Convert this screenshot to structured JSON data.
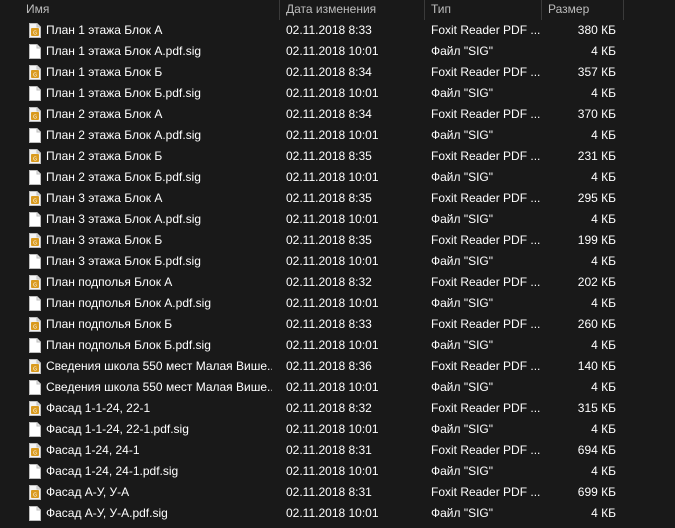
{
  "header": {
    "name": "Имя",
    "date": "Дата изменения",
    "type": "Тип",
    "size": "Размер"
  },
  "rows": [
    {
      "name": "План 1 этажа Блок А",
      "date": "02.11.2018 8:33",
      "type": "Foxit Reader PDF ...",
      "size": "380 КБ",
      "icon": "pdf-file-icon"
    },
    {
      "name": "План 1 этажа Блок А.pdf.sig",
      "date": "02.11.2018 10:01",
      "type": "Файл \"SIG\"",
      "size": "4 КБ",
      "icon": "blank-file-icon"
    },
    {
      "name": "План 1 этажа Блок Б",
      "date": "02.11.2018 8:34",
      "type": "Foxit Reader PDF ...",
      "size": "357 КБ",
      "icon": "pdf-file-icon"
    },
    {
      "name": "План 1 этажа Блок Б.pdf.sig",
      "date": "02.11.2018 10:01",
      "type": "Файл \"SIG\"",
      "size": "4 КБ",
      "icon": "blank-file-icon"
    },
    {
      "name": "План 2 этажа Блок А",
      "date": "02.11.2018 8:34",
      "type": "Foxit Reader PDF ...",
      "size": "370 КБ",
      "icon": "pdf-file-icon"
    },
    {
      "name": "План 2 этажа Блок А.pdf.sig",
      "date": "02.11.2018 10:01",
      "type": "Файл \"SIG\"",
      "size": "4 КБ",
      "icon": "blank-file-icon"
    },
    {
      "name": "План 2 этажа Блок Б",
      "date": "02.11.2018 8:35",
      "type": "Foxit Reader PDF ...",
      "size": "231 КБ",
      "icon": "pdf-file-icon"
    },
    {
      "name": "План 2 этажа Блок Б.pdf.sig",
      "date": "02.11.2018 10:01",
      "type": "Файл \"SIG\"",
      "size": "4 КБ",
      "icon": "blank-file-icon"
    },
    {
      "name": "План 3 этажа Блок А",
      "date": "02.11.2018 8:35",
      "type": "Foxit Reader PDF ...",
      "size": "295 КБ",
      "icon": "pdf-file-icon"
    },
    {
      "name": "План 3 этажа Блок А.pdf.sig",
      "date": "02.11.2018 10:01",
      "type": "Файл \"SIG\"",
      "size": "4 КБ",
      "icon": "blank-file-icon"
    },
    {
      "name": "План 3 этажа Блок Б",
      "date": "02.11.2018 8:35",
      "type": "Foxit Reader PDF ...",
      "size": "199 КБ",
      "icon": "pdf-file-icon"
    },
    {
      "name": "План 3 этажа Блок Б.pdf.sig",
      "date": "02.11.2018 10:01",
      "type": "Файл \"SIG\"",
      "size": "4 КБ",
      "icon": "blank-file-icon"
    },
    {
      "name": "План подполья Блок А",
      "date": "02.11.2018 8:32",
      "type": "Foxit Reader PDF ...",
      "size": "202 КБ",
      "icon": "pdf-file-icon"
    },
    {
      "name": "План подполья Блок А.pdf.sig",
      "date": "02.11.2018 10:01",
      "type": "Файл \"SIG\"",
      "size": "4 КБ",
      "icon": "blank-file-icon"
    },
    {
      "name": "План подполья Блок Б",
      "date": "02.11.2018 8:33",
      "type": "Foxit Reader PDF ...",
      "size": "260 КБ",
      "icon": "pdf-file-icon"
    },
    {
      "name": "План подполья Блок Б.pdf.sig",
      "date": "02.11.2018 10:01",
      "type": "Файл \"SIG\"",
      "size": "4 КБ",
      "icon": "blank-file-icon"
    },
    {
      "name": "Сведения школа 550 мест Малая Више...",
      "date": "02.11.2018 8:36",
      "type": "Foxit Reader PDF ...",
      "size": "140 КБ",
      "icon": "pdf-file-icon"
    },
    {
      "name": "Сведения школа 550 мест Малая Више...",
      "date": "02.11.2018 10:01",
      "type": "Файл \"SIG\"",
      "size": "4 КБ",
      "icon": "blank-file-icon"
    },
    {
      "name": "Фасад 1-1-24, 22-1",
      "date": "02.11.2018 8:32",
      "type": "Foxit Reader PDF ...",
      "size": "315 КБ",
      "icon": "pdf-file-icon"
    },
    {
      "name": "Фасад 1-1-24, 22-1.pdf.sig",
      "date": "02.11.2018 10:01",
      "type": "Файл \"SIG\"",
      "size": "4 КБ",
      "icon": "blank-file-icon"
    },
    {
      "name": "Фасад 1-24, 24-1",
      "date": "02.11.2018 8:31",
      "type": "Foxit Reader PDF ...",
      "size": "694 КБ",
      "icon": "pdf-file-icon"
    },
    {
      "name": "Фасад 1-24, 24-1.pdf.sig",
      "date": "02.11.2018 10:01",
      "type": "Файл \"SIG\"",
      "size": "4 КБ",
      "icon": "blank-file-icon"
    },
    {
      "name": "Фасад А-У, У-А",
      "date": "02.11.2018 8:31",
      "type": "Foxit Reader PDF ...",
      "size": "699 КБ",
      "icon": "pdf-file-icon"
    },
    {
      "name": "Фасад А-У, У-А.pdf.sig",
      "date": "02.11.2018 10:01",
      "type": "Файл \"SIG\"",
      "size": "4 КБ",
      "icon": "blank-file-icon"
    }
  ]
}
